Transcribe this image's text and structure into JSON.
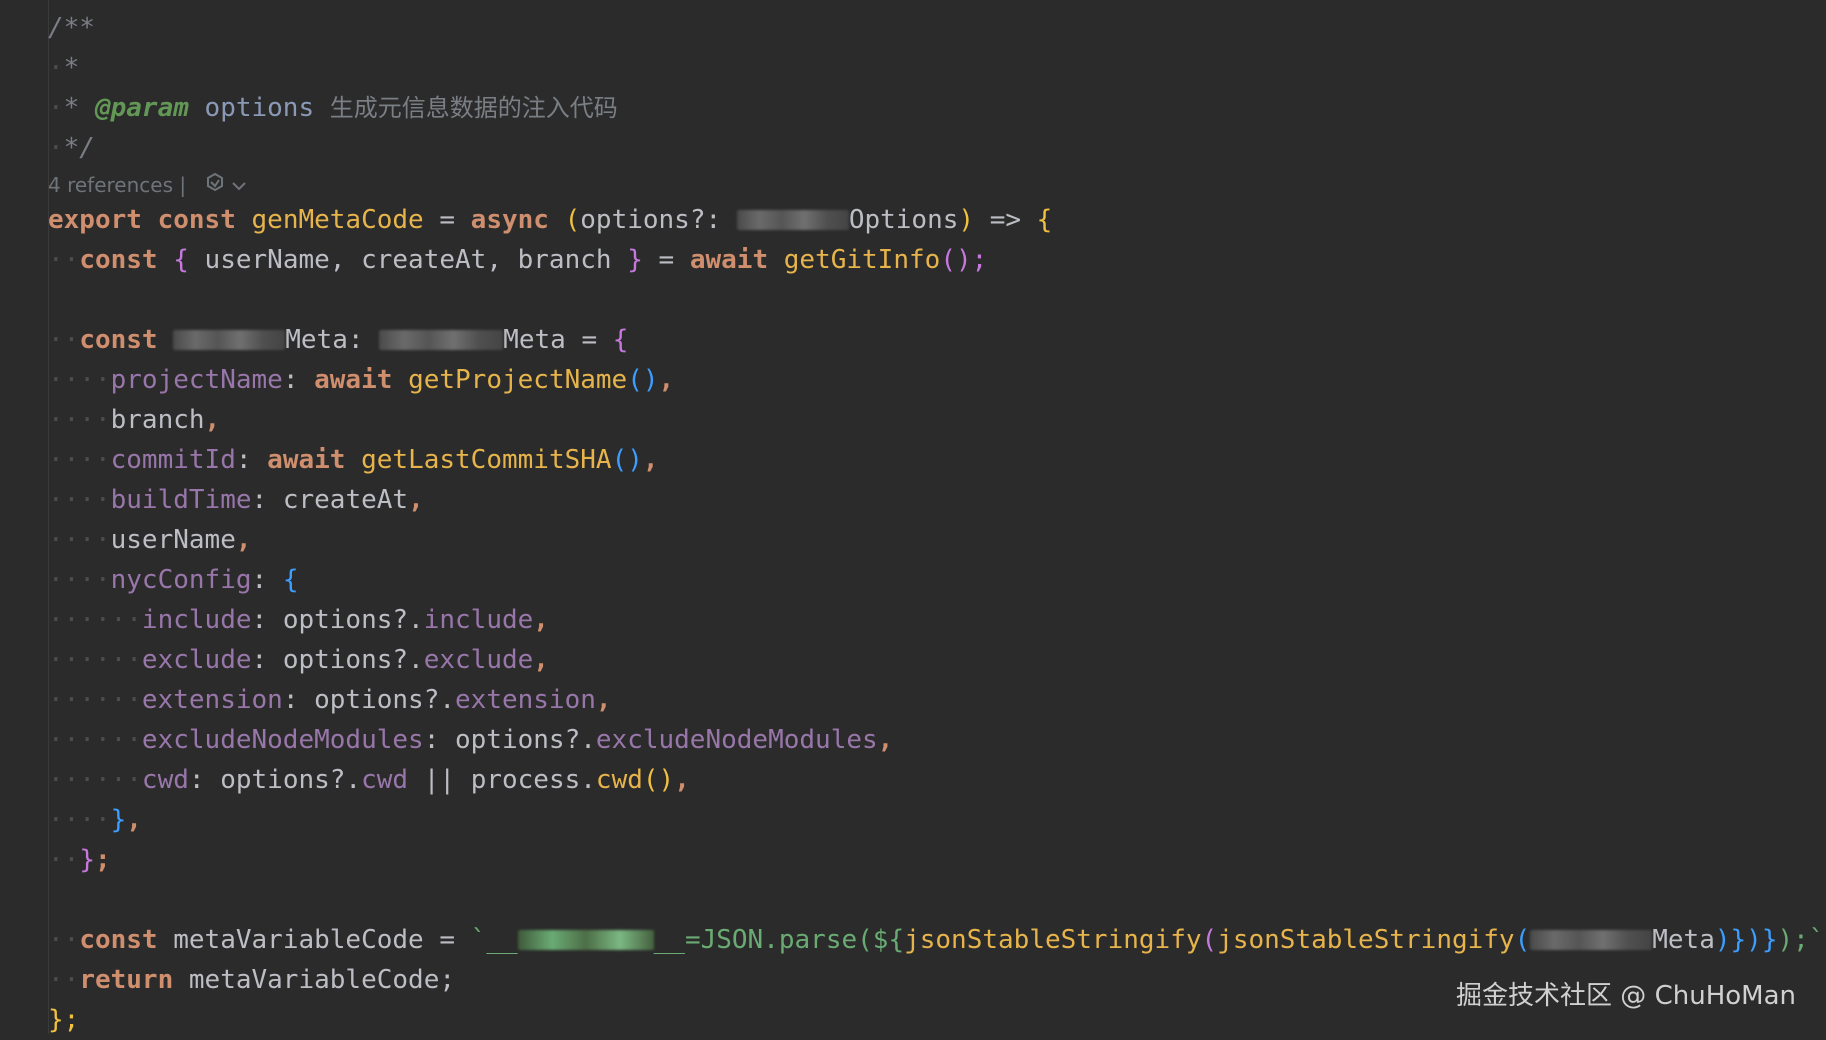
{
  "code": {
    "doc_open": "/**",
    "doc_star": "*",
    "doc_param_star": "* ",
    "doc_param_tag": "@param",
    "doc_param_name": " options ",
    "doc_param_desc": "生成元信息数据的注入代码",
    "doc_close": "*/",
    "references_hint": "4 references |",
    "l_export": "export",
    "l_const": "const",
    "l_fn_name": "genMetaCode",
    "l_eq": " = ",
    "l_async": "async",
    "l_paren_open": "(",
    "l_options_param": "options?: ",
    "l_options_type_suffix": "Options",
    "l_paren_close": ")",
    "l_arrow": " => ",
    "l_brace_open": "{",
    "git_const": "const",
    "git_destructure": " userName, createAt, branch ",
    "git_eq": " = ",
    "git_await": "await",
    "git_fn": "getGitInfo",
    "git_call": "();",
    "meta_const": "const",
    "meta_name_suffix": "Meta: ",
    "meta_type_suffix": "Meta",
    "meta_eq": " = ",
    "projectName_key": "projectName",
    "colon": ": ",
    "await": "await",
    "getProjectName": "getProjectName",
    "call_comma": "(),",
    "branch": "branch",
    "comma": ",",
    "commitId_key": "commitId",
    "getLastCommitSHA": "getLastCommitSHA",
    "buildTime_key": "buildTime",
    "createAt": "createAt",
    "userName": "userName",
    "nycConfig_key": "nycConfig",
    "include_key": "include",
    "options_opt": "options?.",
    "include_val": "include",
    "exclude_key": "exclude",
    "exclude_val": "exclude",
    "extension_key": "extension",
    "extension_val": "extension",
    "excludeNodeModules_key": "excludeNodeModules",
    "excludeNodeModules_val": "excludeNodeModules",
    "cwd_key": "cwd",
    "cwd_val": "cwd",
    "or": " || ",
    "process": "process.",
    "cwd_fn": "cwd",
    "nyc_close": "},",
    "meta_close": "};",
    "mvc_const": "const",
    "mvc_name": " metaVariableCode = ",
    "mvc_tpl_start": "`__",
    "mvc_tpl_mid": "__=JSON.parse(${",
    "mvc_fn1": "jsonStableStringify",
    "mvc_fn2": "jsonStableStringify",
    "mvc_arg_suffix": "Meta",
    "mvc_tpl_end": ")})}",
    "mvc_tail": ");`;",
    "return_kw": "return",
    "return_val": " metaVariableCode;",
    "fn_close": "};"
  },
  "watermark": "掘金技术社区 @ ChuHoMan"
}
